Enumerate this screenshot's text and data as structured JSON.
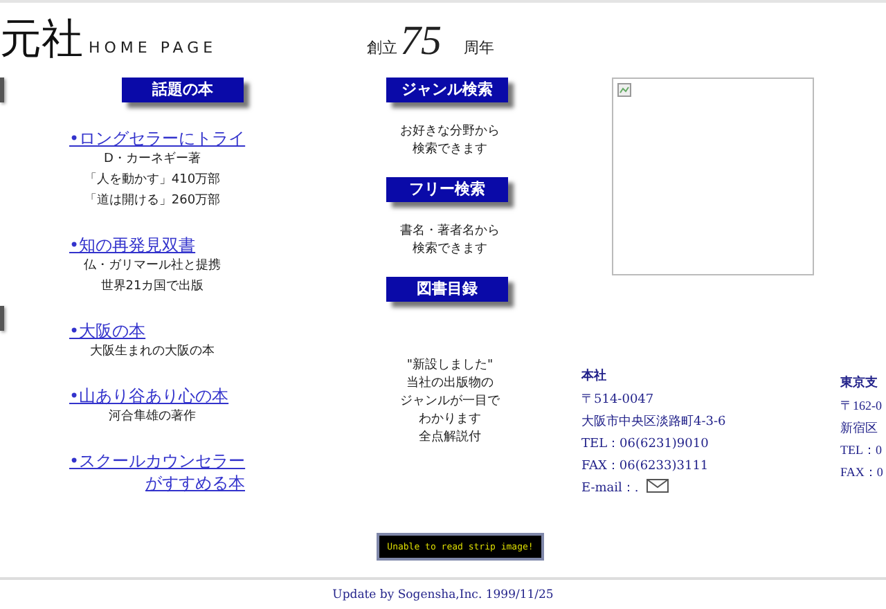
{
  "header": {
    "title": "元社",
    "subtitle": "HOME PAGE",
    "anniversary": {
      "prefix": "創立",
      "number": "75",
      "suffix": "周年"
    }
  },
  "featured": {
    "heading": "話題の本",
    "items": [
      {
        "link": [
          "•ロングセラーにトライ"
        ],
        "notes": [
          "D・カーネギー著",
          "「人を動かす」410万部",
          "「道は開ける」260万部"
        ]
      },
      {
        "link": [
          "•知の再発見双書"
        ],
        "notes": [
          "仏・ガリマール社と提携",
          "世界21カ国で出版"
        ]
      },
      {
        "link": [
          "•大阪の本"
        ],
        "notes": [
          "大阪生まれの大阪の本"
        ]
      },
      {
        "link": [
          "•山あり谷あり心の本"
        ],
        "notes": [
          "河合隼雄の著作"
        ]
      },
      {
        "link": [
          "•スクールカウンセラー",
          "がすすめる本"
        ]
      }
    ]
  },
  "search": [
    {
      "button": "ジャンル検索",
      "lines": [
        "お好きな分野から",
        "検索できます"
      ]
    },
    {
      "button": "フリー検索",
      "lines": [
        "書名・著者名から",
        "検索できます"
      ]
    },
    {
      "button": "図書目録"
    }
  ],
  "catalog_note": [
    "\"新設しました\"",
    "当社の出版物の",
    "ジャンルが一目で",
    "わかります",
    "全点解説付"
  ],
  "head_office": {
    "name": "本社",
    "lines": [
      "〒514-0047",
      "大阪市中央区淡路町4-3-6",
      "TEL：06(6231)9010",
      "FAX：06(6233)3111"
    ],
    "email_label": "E-mail：."
  },
  "tokyo_branch": {
    "name": "東京支",
    "lines": [
      "〒162-0",
      "新宿区",
      "TEL：0",
      "FAX：0"
    ]
  },
  "strip": {
    "message": "Unable to read strip image!"
  },
  "footer": "Update by Sogensha,Inc. 1999/11/25"
}
